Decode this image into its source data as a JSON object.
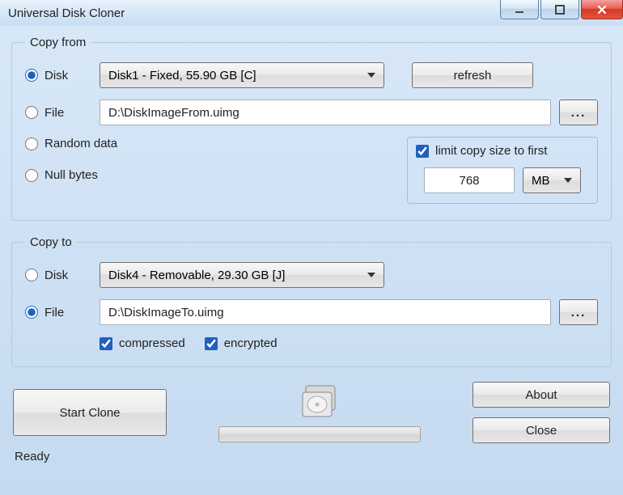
{
  "window": {
    "title": "Universal Disk Cloner"
  },
  "copy_from": {
    "legend": "Copy from",
    "disk_label": "Disk",
    "disk_value": "Disk1 - Fixed, 55.90 GB  [C]",
    "disk_selected": true,
    "refresh_label": "refresh",
    "file_label": "File",
    "file_value": "D:\\DiskImageFrom.uimg",
    "file_selected": false,
    "browse_label": "...",
    "random_label": "Random data",
    "random_selected": false,
    "null_label": "Null bytes",
    "null_selected": false,
    "limit": {
      "check_label": "limit copy size to first",
      "checked": true,
      "value": "768",
      "unit": "MB"
    }
  },
  "copy_to": {
    "legend": "Copy to",
    "disk_label": "Disk",
    "disk_value": "Disk4 - Removable, 29.30 GB  [J]",
    "disk_selected": false,
    "file_label": "File",
    "file_value": "D:\\DiskImageTo.uimg",
    "file_selected": true,
    "browse_label": "...",
    "compressed_label": "compressed",
    "compressed_checked": true,
    "encrypted_label": "encrypted",
    "encrypted_checked": true
  },
  "bottom": {
    "start_label": "Start Clone",
    "about_label": "About",
    "close_label": "Close"
  },
  "status": {
    "text": "Ready"
  }
}
